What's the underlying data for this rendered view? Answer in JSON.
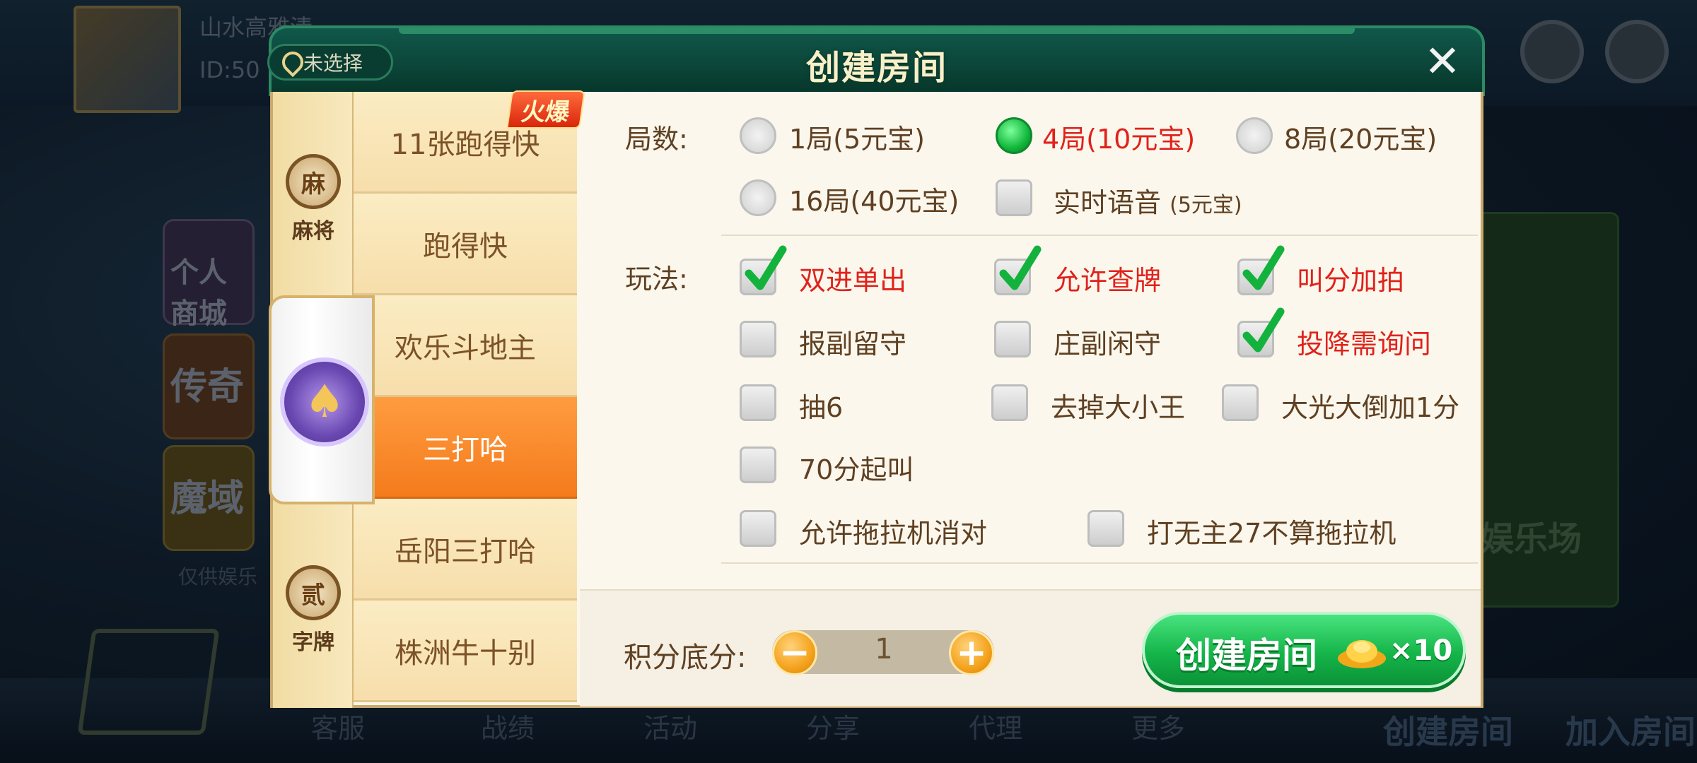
{
  "background": {
    "player_name": "山水高雅清",
    "player_id": "ID:50",
    "side_cards": [
      "个人商城",
      "传奇",
      "魔域"
    ],
    "side_tip": "仅供娱乐",
    "right_panel": "娱乐场",
    "nav": [
      "客服",
      "战绩",
      "活动",
      "分享",
      "代理",
      "更多"
    ],
    "nav_create": "创建房间",
    "nav_join": "加入房间"
  },
  "header": {
    "title": "创建房间",
    "location_label": "未选择",
    "close_label": "✕"
  },
  "categories": {
    "mahjong": {
      "label": "麻将",
      "icon": "麻"
    },
    "poker": {
      "icon": "♠"
    },
    "zipai": {
      "label": "字牌",
      "icon": "贰"
    }
  },
  "hot_badge": "火爆",
  "games": [
    {
      "label": "11张跑得快",
      "active": false
    },
    {
      "label": "跑得快",
      "active": false
    },
    {
      "label": "欢乐斗地主",
      "active": false
    },
    {
      "label": "三打哈",
      "active": true
    },
    {
      "label": "岳阳三打哈",
      "active": false
    },
    {
      "label": "株洲牛十别",
      "active": false
    }
  ],
  "rounds": {
    "label": "局数:",
    "options": [
      {
        "label": "1局(5元宝)",
        "selected": false
      },
      {
        "label": "4局(10元宝)",
        "selected": true
      },
      {
        "label": "8局(20元宝)",
        "selected": false
      },
      {
        "label": "16局(40元宝)",
        "selected": false
      }
    ],
    "voice": {
      "label": "实时语音",
      "note": "(5元宝)",
      "checked": false
    }
  },
  "rules": {
    "label": "玩法:",
    "options": [
      {
        "label": "双进单出",
        "checked": true
      },
      {
        "label": "允许查牌",
        "checked": true
      },
      {
        "label": "叫分加拍",
        "checked": true
      },
      {
        "label": "报副留守",
        "checked": false
      },
      {
        "label": "庄副闲守",
        "checked": false
      },
      {
        "label": "投降需询问",
        "checked": true
      },
      {
        "label": "抽6",
        "checked": false
      },
      {
        "label": "去掉大小王",
        "checked": false
      },
      {
        "label": "大光大倒加1分",
        "checked": false
      },
      {
        "label": "70分起叫",
        "checked": false
      },
      {
        "label": "允许拖拉机消对",
        "checked": false
      },
      {
        "label": "打无主27不算拖拉机",
        "checked": false
      }
    ]
  },
  "score": {
    "label": "积分底分:",
    "value": "1",
    "minus": "−",
    "plus": "+"
  },
  "create_button": {
    "label": "创建房间",
    "multiplier": "×10"
  },
  "colors": {
    "header_green": "#0b4438",
    "active_orange": "#f47b1c",
    "checked_red": "#e0221b",
    "body_text": "#5f4022",
    "create_green": "#15b54a"
  }
}
